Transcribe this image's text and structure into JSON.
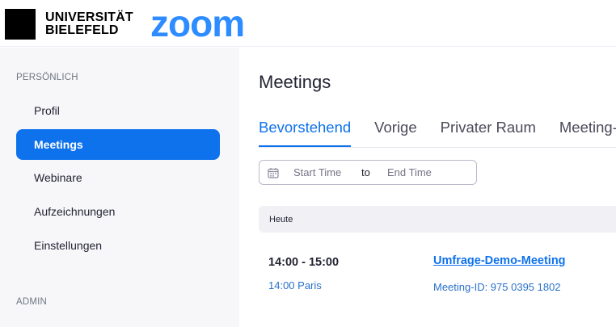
{
  "header": {
    "university_name_line1": "UNIVERSITÄT",
    "university_name_line2": "BIELEFELD",
    "product_logo": "zoom",
    "brand_color": "#2d8cff"
  },
  "sidebar": {
    "section_personal": "PERSÖNLICH",
    "items": [
      {
        "label": "Profil"
      },
      {
        "label": "Meetings",
        "active": true
      },
      {
        "label": "Webinare"
      },
      {
        "label": "Aufzeichnungen"
      },
      {
        "label": "Einstellungen"
      }
    ],
    "section_admin": "ADMIN",
    "active_color": "#0e72ed"
  },
  "main": {
    "title": "Meetings",
    "tabs": [
      {
        "label": "Bevorstehend",
        "active": true
      },
      {
        "label": "Vorige"
      },
      {
        "label": "Privater Raum"
      },
      {
        "label": "Meeting-Vorlagen"
      }
    ],
    "date_filter": {
      "start_placeholder": "Start Time",
      "separator": "to",
      "end_placeholder": "End Time",
      "icon": "calendar-icon"
    },
    "day_group": "Heute",
    "meetings": [
      {
        "time": "14:00 - 15:00",
        "local_time": "14:00 Paris",
        "topic": "Umfrage-Demo-Meeting",
        "meeting_id": "Meeting-ID: 975 0395 1802"
      }
    ]
  }
}
